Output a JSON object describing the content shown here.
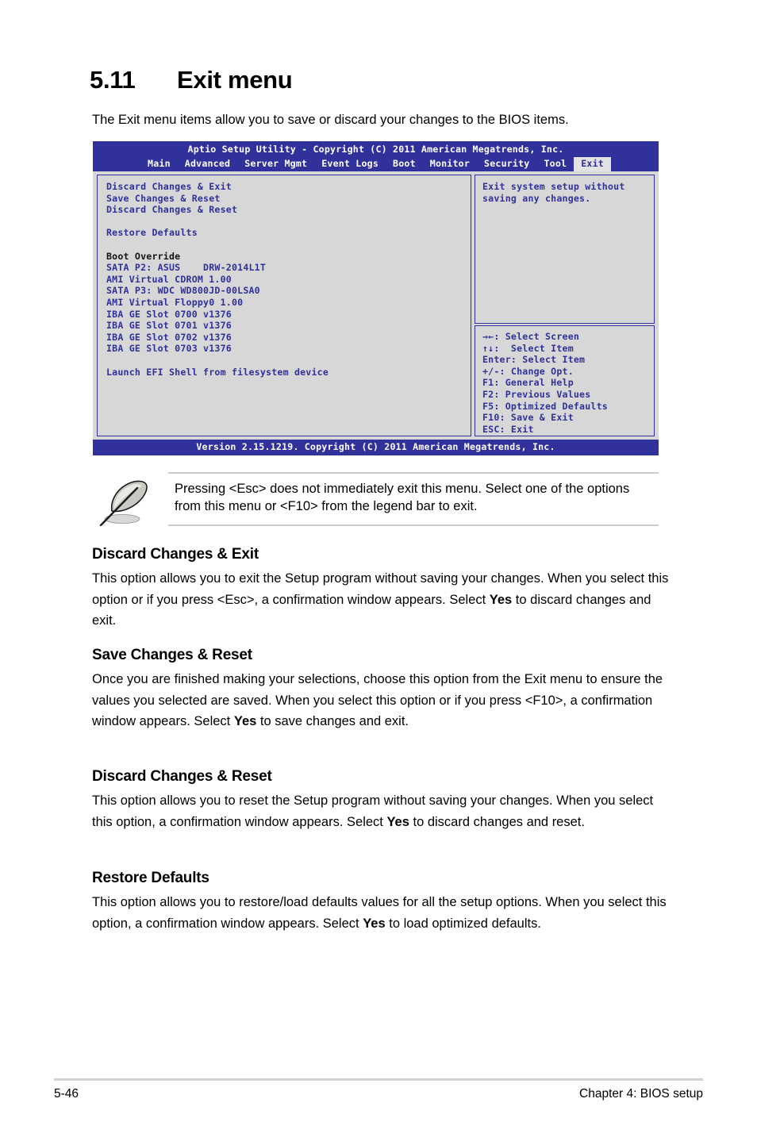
{
  "heading": {
    "number": "5.11",
    "title": "Exit menu"
  },
  "intro": "The Exit menu items allow you to save or discard your changes to the BIOS items.",
  "bios": {
    "title": "Aptio Setup Utility - Copyright (C) 2011 American Megatrends, Inc.",
    "tabs": [
      {
        "label": "Main",
        "active": false
      },
      {
        "label": "Advanced",
        "active": false
      },
      {
        "label": "Server Mgmt",
        "active": false
      },
      {
        "label": "Event Logs",
        "active": false
      },
      {
        "label": "Boot",
        "active": false
      },
      {
        "label": "Monitor",
        "active": false
      },
      {
        "label": "Security",
        "active": false
      },
      {
        "label": "Tool",
        "active": false
      },
      {
        "label": "Exit",
        "active": true
      }
    ],
    "menu_items": [
      {
        "text": "Discard Changes & Exit",
        "style": "blue"
      },
      {
        "text": "Save Changes & Reset",
        "style": "blue"
      },
      {
        "text": "Discard Changes & Reset",
        "style": "blue"
      },
      {
        "text": "",
        "style": "spacer"
      },
      {
        "text": "Restore Defaults",
        "style": "blue"
      },
      {
        "text": "",
        "style": "spacer"
      },
      {
        "text": "Boot Override",
        "style": "dark"
      },
      {
        "text": "SATA P2: ASUS    DRW-2014L1T",
        "style": "blue"
      },
      {
        "text": "AMI Virtual CDROM 1.00",
        "style": "blue"
      },
      {
        "text": "SATA P3: WDC WD800JD-00LSA0",
        "style": "blue"
      },
      {
        "text": "AMI Virtual Floppy0 1.00",
        "style": "blue"
      },
      {
        "text": "IBA GE Slot 0700 v1376",
        "style": "blue"
      },
      {
        "text": "IBA GE Slot 0701 v1376",
        "style": "blue"
      },
      {
        "text": "IBA GE Slot 0702 v1376",
        "style": "blue"
      },
      {
        "text": "IBA GE Slot 0703 v1376",
        "style": "blue"
      },
      {
        "text": "",
        "style": "spacer"
      },
      {
        "text": "Launch EFI Shell from filesystem device",
        "style": "blue"
      }
    ],
    "help_lines": [
      "Exit system setup without",
      "saving any changes."
    ],
    "legend_lines": [
      "→←: Select Screen",
      "↑↓:  Select Item",
      "Enter: Select Item",
      "+/-: Change Opt.",
      "F1: General Help",
      "F2: Previous Values",
      "F5: Optimized Defaults",
      "F10: Save & Exit",
      "ESC: Exit"
    ],
    "footer": "Version 2.15.1219. Copyright (C) 2011 American Megatrends, Inc.",
    "colors": {
      "chrome_blue": "#30319b",
      "panel_bg": "#d7d7d7",
      "active_tab_bg": "#e2e2e2",
      "text_dark": "#111111"
    }
  },
  "note": {
    "icon_name": "quill-pen-icon",
    "text": "Pressing <Esc> does not immediately exit this menu. Select one of the options from this menu or <F10> from the legend bar to exit."
  },
  "sections": [
    {
      "heading": "Discard Changes & Exit",
      "body_pre": "This option allows you to exit the Setup program without saving your changes. When you select this option or if you press <Esc>, a confirmation window appears. Select ",
      "body_bold": "Yes",
      "body_post": " to discard changes and exit."
    },
    {
      "heading": "Save Changes & Reset",
      "body_pre": "Once you are finished making your selections, choose this option from the Exit menu to ensure the values you selected are saved. When you select this option or if you press <F10>, a confirmation window appears. Select ",
      "body_bold": "Yes",
      "body_post": " to save changes and exit."
    },
    {
      "heading": "Discard Changes & Reset",
      "body_pre": "This option allows you to reset the Setup program without saving your changes. When you select this option, a confirmation window appears. Select ",
      "body_bold": "Yes",
      "body_post": " to discard changes and reset."
    },
    {
      "heading": "Restore Defaults",
      "body_pre": "This option allows you to restore/load defaults values for all the setup options. When you select this option, a confirmation window appears. Select ",
      "body_bold": "Yes",
      "body_post": " to load optimized defaults."
    }
  ],
  "footer": {
    "page_number": "5-46",
    "chapter": "Chapter 4: BIOS setup"
  }
}
